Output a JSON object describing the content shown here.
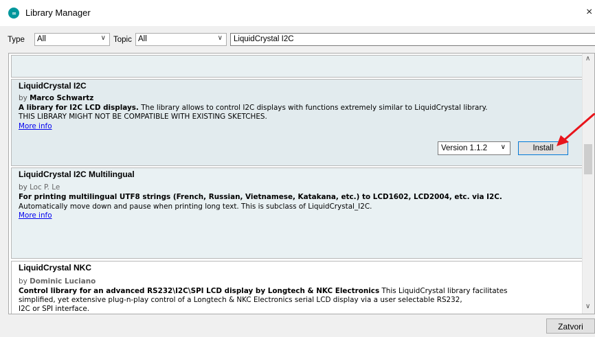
{
  "window": {
    "icon_text": "∞",
    "title": "Library Manager",
    "close_glyph": "×"
  },
  "filters": {
    "type_label": "Type",
    "type_value": "All",
    "topic_label": "Topic",
    "topic_value": "All",
    "search_value": "LiquidCrystal I2C"
  },
  "libraries": [
    {
      "name": "LiquidCrystal I2C",
      "by_prefix": "by",
      "author": "Marco Schwartz",
      "summary": "A library for I2C LCD displays.",
      "description": "The library allows to control I2C displays with functions extremely similar to LiquidCrystal library.",
      "warning": "THIS LIBRARY MIGHT NOT BE COMPATIBLE WITH EXISTING SKETCHES.",
      "more_info": "More info",
      "version_selected": "Version 1.1.2",
      "install_label": "Install"
    },
    {
      "name": "LiquidCrystal I2C Multilingual",
      "by_prefix": "by",
      "author": "Loc P. Le",
      "summary": "For printing multilingual UTF8 strings (French, Russian, Vietnamese, Katakana, etc.) to LCD1602, LCD2004, etc. via I2C.",
      "description": "Automatically move down and pause when printing long text. This is subclass of LiquidCrystal_I2C.",
      "more_info": "More info"
    },
    {
      "name": "LiquidCrystal NKC",
      "by_prefix": "by",
      "author": "Dominic Luciano",
      "summary": "Control library for an advanced RS232\\I2C\\SPI LCD display by Longtech & NKC Electronics",
      "description_line1": "This LiquidCrystal library facilitates",
      "description_line2": "simplified, yet extensive plug-n-play control of a Longtech & NKC Electronics serial LCD display via a user selectable RS232,",
      "description_line3": "I2C or SPI interface."
    }
  ],
  "footer": {
    "close_label": "Zatvori"
  },
  "colors": {
    "accent": "#0078d7",
    "link": "#0000ee",
    "annotation_arrow": "#e8141b",
    "app_icon": "#00979c"
  }
}
